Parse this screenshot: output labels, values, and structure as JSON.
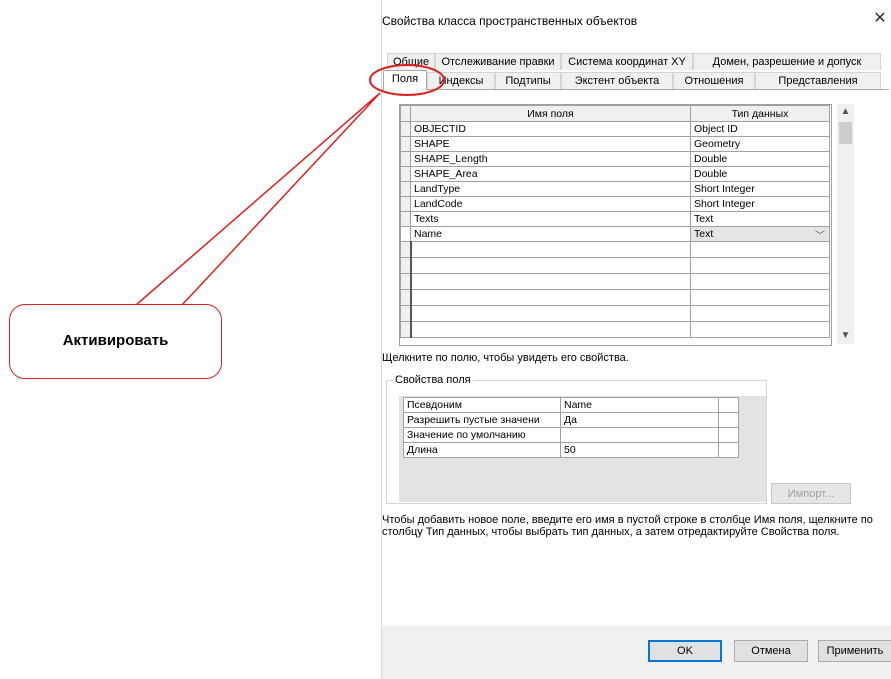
{
  "dialog": {
    "title": "Свойства класса пространственных объектов",
    "close_glyph": "✕"
  },
  "tabs_row1": [
    "Общие",
    "Отслеживание правки",
    "Система координат XY",
    "Домен, разрешение и допуск"
  ],
  "tabs_row2": [
    "Поля",
    "Индексы",
    "Подтипы",
    "Экстент объекта",
    "Отношения",
    "Представления"
  ],
  "active_tab": "Поля",
  "fields_grid": {
    "headers": [
      "Имя поля",
      "Тип данных"
    ],
    "rows": [
      {
        "name": "OBJECTID",
        "type": "Object ID"
      },
      {
        "name": "SHAPE",
        "type": "Geometry"
      },
      {
        "name": "SHAPE_Length",
        "type": "Double"
      },
      {
        "name": "SHAPE_Area",
        "type": "Double"
      },
      {
        "name": "LandType",
        "type": "Short Integer"
      },
      {
        "name": "LandCode",
        "type": "Short Integer"
      },
      {
        "name": "Texts",
        "type": "Text"
      },
      {
        "name": "Name",
        "type": "Text"
      }
    ],
    "empty_rows": 6,
    "current_row": 7
  },
  "hint_select": "Щелкните по полю, чтобы увидеть его свойства.",
  "field_properties": {
    "legend": "Свойства поля",
    "rows": [
      {
        "label": "Псевдоним",
        "value": "Name"
      },
      {
        "label": "Разрешить пустые значени",
        "value": "Да"
      },
      {
        "label": "Значение по умолчанию",
        "value": ""
      },
      {
        "label": "Длина",
        "value": "50"
      }
    ]
  },
  "import_label": "Импорт...",
  "hint_add": "Чтобы добавить новое поле, введите его имя в пустой строке в столбце Имя поля, щелкните по столбцу Тип данных, чтобы выбрать тип данных, а затем отредактируйте Свойства поля.",
  "buttons": {
    "ok": "OK",
    "cancel": "Отмена",
    "apply": "Применить"
  },
  "annotation": {
    "label": "Активировать",
    "color": "#e02020"
  }
}
